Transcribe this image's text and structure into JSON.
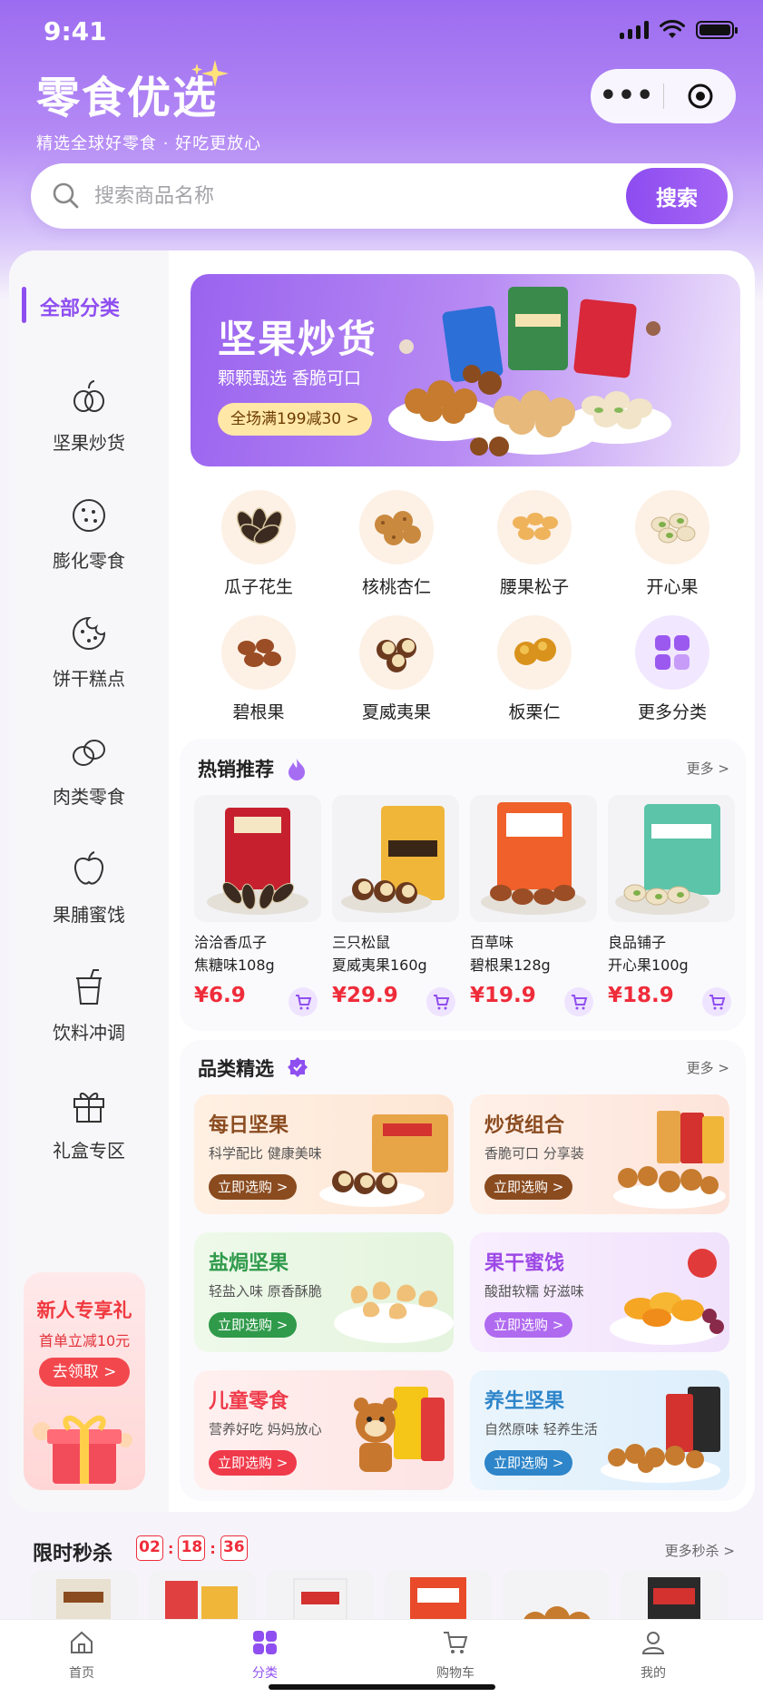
{
  "status": {
    "time": "9:41"
  },
  "brand": {
    "title": "零食优选",
    "subtitle": "精选全球好零食 · 好吃更放心",
    "accent": "#8f4ff0"
  },
  "search": {
    "placeholder": "搜索商品名称",
    "button": "搜索"
  },
  "sidebar": {
    "active": "全部分类",
    "items": [
      {
        "label": "坚果炒货",
        "icon": "nuts-icon"
      },
      {
        "label": "膨化零食",
        "icon": "cookie-icon"
      },
      {
        "label": "饼干糕点",
        "icon": "biscuit-icon"
      },
      {
        "label": "肉类零食",
        "icon": "meat-icon"
      },
      {
        "label": "果脯蜜饯",
        "icon": "fruit-icon"
      },
      {
        "label": "饮料冲调",
        "icon": "drink-icon"
      },
      {
        "label": "礼盒专区",
        "icon": "gift-icon"
      }
    ],
    "promo": {
      "title": "新人专享礼",
      "subtitle": "首单立减10元",
      "button": "去领取 >"
    }
  },
  "banner": {
    "title": "坚果炒货",
    "subtitle": "颗颗甄选 香脆可口",
    "badge": "全场满199减30 >"
  },
  "categories": [
    {
      "label": "瓜子花生"
    },
    {
      "label": "核桃杏仁"
    },
    {
      "label": "腰果松子"
    },
    {
      "label": "开心果"
    },
    {
      "label": "碧根果"
    },
    {
      "label": "夏威夷果"
    },
    {
      "label": "板栗仁"
    },
    {
      "label": "更多分类"
    }
  ],
  "hot": {
    "title": "热销推荐",
    "more": "更多 >",
    "products": [
      {
        "line1": "洽洽香瓜子",
        "line2": "焦糖味108g",
        "price": "¥6.9"
      },
      {
        "line1": "三只松鼠",
        "line2": "夏威夷果160g",
        "price": "¥29.9"
      },
      {
        "line1": "百草味",
        "line2": "碧根果128g",
        "price": "¥19.9"
      },
      {
        "line1": "良品铺子",
        "line2": "开心果100g",
        "price": "¥18.9"
      }
    ]
  },
  "picks": {
    "title": "品类精选",
    "more": "更多 >",
    "items": [
      {
        "title": "每日坚果",
        "subtitle": "科学配比 健康美味",
        "button": "立即选购 >",
        "color": "#8a4b1f"
      },
      {
        "title": "炒货组合",
        "subtitle": "香脆可口 分享装",
        "button": "立即选购 >",
        "color": "#8a4b1f"
      },
      {
        "title": "盐焗坚果",
        "subtitle": "轻盐入味 原香酥脆",
        "button": "立即选购 >",
        "color": "#2f9a4a"
      },
      {
        "title": "果干蜜饯",
        "subtitle": "酸甜软糯 好滋味",
        "button": "立即选购 >",
        "color": "#9d48e6"
      },
      {
        "title": "儿童零食",
        "subtitle": "营养好吃 妈妈放心",
        "button": "立即选购 >",
        "color": "#ef3a4a"
      },
      {
        "title": "养生坚果",
        "subtitle": "自然原味 轻养生活",
        "button": "立即选购 >",
        "color": "#2e85c9"
      }
    ]
  },
  "flash": {
    "title": "限时秒杀",
    "h": "02",
    "m": "18",
    "s": "36",
    "more": "更多秒杀 >"
  },
  "tabs": [
    {
      "label": "首页"
    },
    {
      "label": "分类"
    },
    {
      "label": "购物车"
    },
    {
      "label": "我的"
    }
  ]
}
